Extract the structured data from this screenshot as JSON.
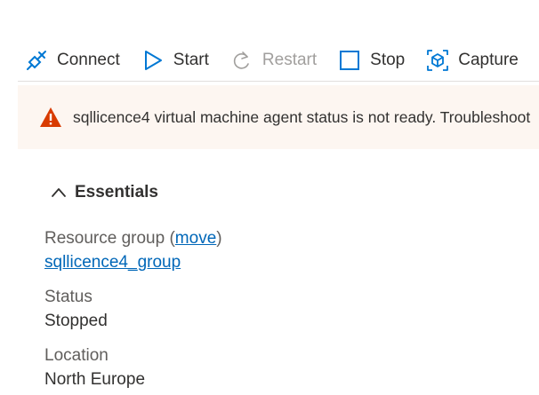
{
  "toolbar": {
    "connect_label": "Connect",
    "start_label": "Start",
    "restart_label": "Restart",
    "stop_label": "Stop",
    "capture_label": "Capture"
  },
  "banner": {
    "message": "sqllicence4 virtual machine agent status is not ready. Troubleshoot"
  },
  "essentials": {
    "title": "Essentials",
    "resource_group_label": "Resource group (",
    "move_link": "move",
    "resource_group_close": ")",
    "resource_group_value": "sqllicence4_group",
    "status_label": "Status",
    "status_value": "Stopped",
    "location_label": "Location",
    "location_value": "North Europe"
  },
  "colors": {
    "accent": "#0078d4",
    "link": "#0067b8",
    "warning": "#d83b01",
    "banner_bg": "#fdf6f1",
    "disabled": "#a19f9d"
  },
  "icons": {
    "connect": "plug-icon",
    "start": "play-icon",
    "restart": "restart-icon",
    "stop": "stop-icon",
    "capture": "capture-icon",
    "warning": "warning-icon",
    "chevron": "chevron-up-icon"
  }
}
